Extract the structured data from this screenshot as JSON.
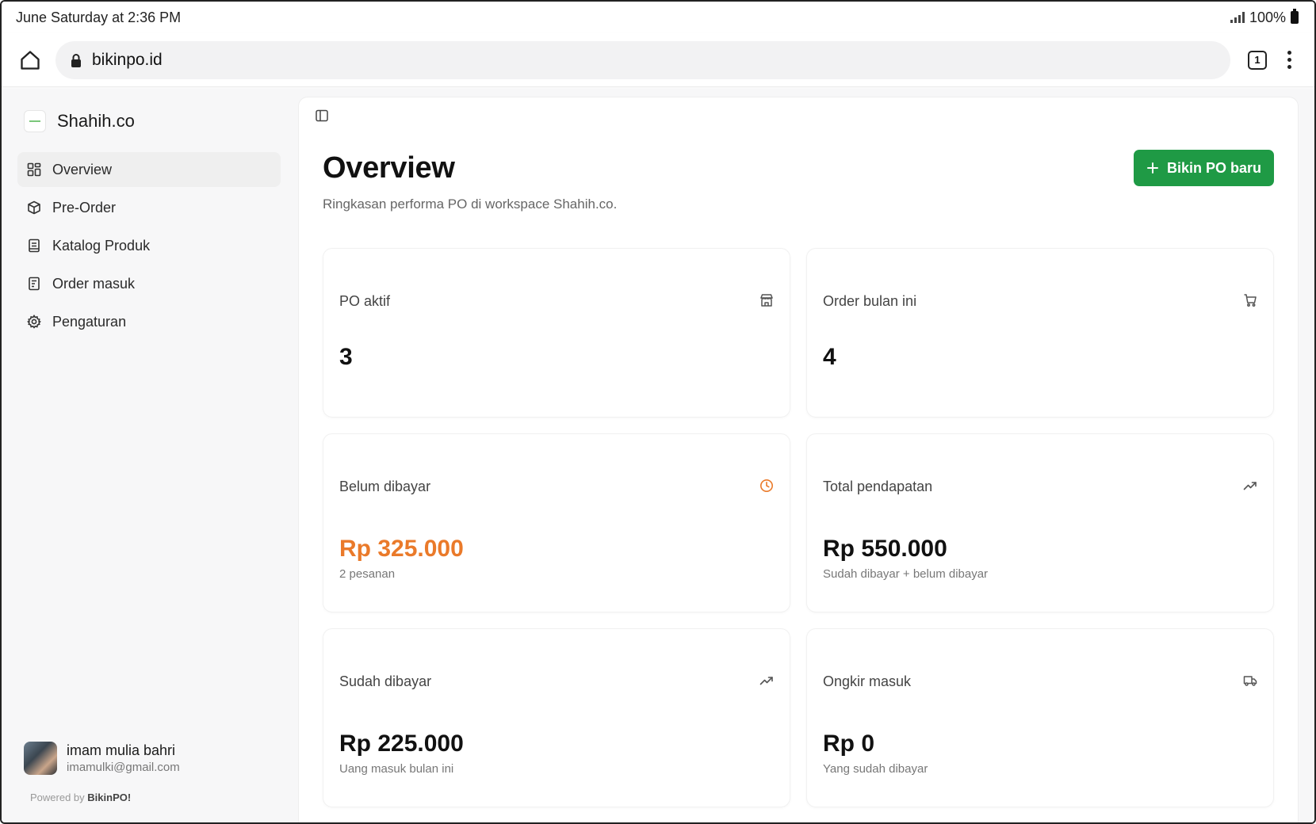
{
  "status": {
    "time": "June Saturday at 2:36 PM",
    "battery": "100%"
  },
  "browser": {
    "url": "bikinpo.id",
    "tab_count": "1"
  },
  "sidebar": {
    "brand": "Shahih.co",
    "items": [
      {
        "label": "Overview",
        "icon": "grid-icon",
        "active": true
      },
      {
        "label": "Pre-Order",
        "icon": "box-icon"
      },
      {
        "label": "Katalog Produk",
        "icon": "book-icon"
      },
      {
        "label": "Order masuk",
        "icon": "receipt-icon"
      },
      {
        "label": "Pengaturan",
        "icon": "gear-icon"
      }
    ],
    "user": {
      "name": "imam mulia bahri",
      "email": "imamulki@gmail.com"
    },
    "powered_prefix": "Powered by",
    "powered_brand": "BikinPO!"
  },
  "main": {
    "title": "Overview",
    "subtitle": "Ringkasan performa PO di workspace Shahih.co.",
    "new_po_label": "Bikin PO baru",
    "cards": [
      {
        "label": "PO aktif",
        "value": "3",
        "note": "",
        "icon": "store-icon"
      },
      {
        "label": "Order bulan ini",
        "value": "4",
        "note": "",
        "icon": "cart-icon"
      },
      {
        "label": "Belum dibayar",
        "value": "Rp 325.000",
        "note": "2 pesanan",
        "icon": "clock-icon"
      },
      {
        "label": "Total pendapatan",
        "value": "Rp 550.000",
        "note": "Sudah dibayar + belum dibayar",
        "icon": "trending-up-icon"
      },
      {
        "label": "Sudah dibayar",
        "value": "Rp 225.000",
        "note": "Uang masuk bulan ini",
        "icon": "trending-up-icon"
      },
      {
        "label": "Ongkir masuk",
        "value": "Rp 0",
        "note": "Yang sudah dibayar",
        "icon": "truck-icon"
      }
    ]
  },
  "colors": {
    "primary": "#1f9a45",
    "warning": "#ea7a2a"
  }
}
